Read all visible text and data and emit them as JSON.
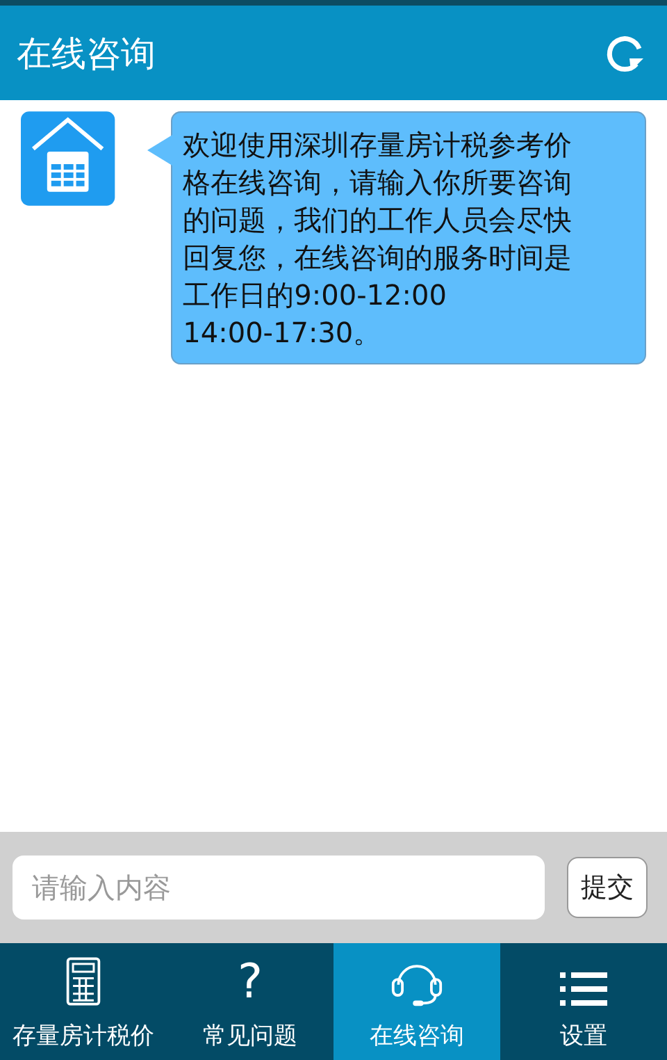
{
  "header": {
    "title": "在线咨询"
  },
  "messages": [
    {
      "lines": [
        "欢迎使用深圳存量房计税参考价",
        "格在线咨询，请输入你所要咨询",
        "的问题，我们的工作人员会尽快",
        "回复您，在线咨询的服务时间是",
        "工作日的9:00-12:00",
        "14:00-17:30。"
      ]
    }
  ],
  "input": {
    "placeholder": "请输入内容",
    "submit": "提交"
  },
  "tabs": [
    {
      "kind": "calculator",
      "label": "存量房计税价",
      "selected": false
    },
    {
      "kind": "question",
      "glyph": "?",
      "label": "常见问题",
      "selected": false
    },
    {
      "kind": "headset",
      "label": "在线咨询",
      "selected": true
    },
    {
      "kind": "list",
      "label": "设置",
      "selected": false
    }
  ]
}
